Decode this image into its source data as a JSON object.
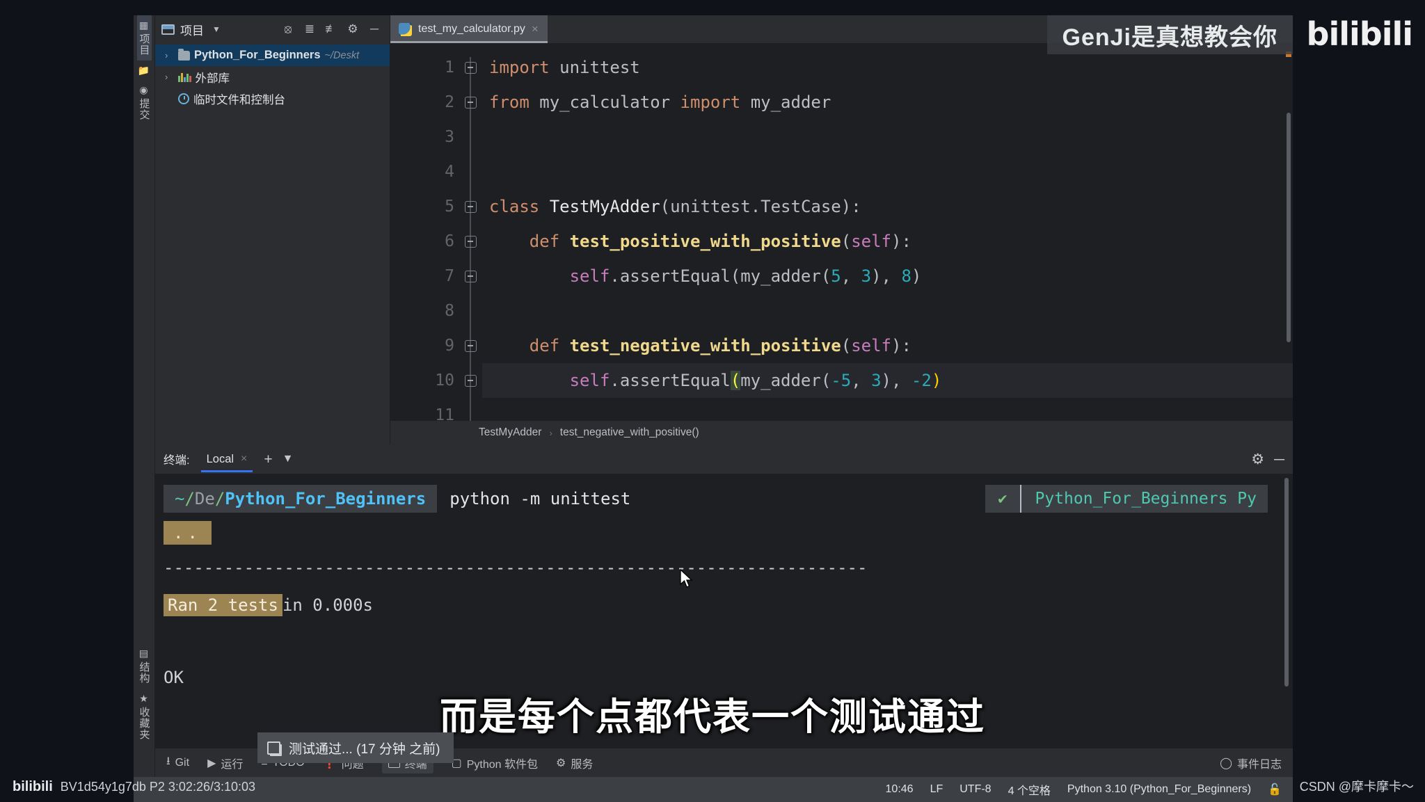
{
  "project": {
    "header_title": "项目",
    "icons": [
      "project-window-icon",
      "dropdown-arrow",
      "locate-icon",
      "expand-all-icon",
      "collapse-all-icon",
      "settings-gear-icon",
      "hide-icon"
    ],
    "tree": [
      {
        "name": "Python_For_Beginners",
        "path": "~/Deskt",
        "arrow": "›",
        "icon": "folder-icon",
        "selected": true
      },
      {
        "name": "外部库",
        "path": "",
        "arrow": "›",
        "icon": "library-icon",
        "selected": false
      },
      {
        "name": "临时文件和控制台",
        "path": "",
        "arrow": "",
        "icon": "scratch-icon",
        "selected": false
      }
    ]
  },
  "toolwindows_left": [
    {
      "label": "项目",
      "icon": "project-icon",
      "active": true
    },
    {
      "label": "提交",
      "icon": "commit-icon",
      "active": false
    },
    {
      "label": "结构",
      "icon": "structure-icon",
      "active": false
    },
    {
      "label": "收藏夹",
      "icon": "bookmarks-star-icon",
      "active": false
    }
  ],
  "editor": {
    "tab": {
      "label": "test_my_calculator.py",
      "icon": "python-file-icon",
      "close": "×"
    },
    "line_numbers": [
      "1",
      "2",
      "3",
      "4",
      "5",
      "6",
      "7",
      "8",
      "9",
      "10",
      "11"
    ],
    "run_markers": [
      5,
      6,
      9
    ],
    "current_line": 10,
    "code": [
      {
        "n": 1,
        "tokens": [
          {
            "t": "import",
            "c": "kw"
          },
          {
            "t": " unittest",
            "c": "plain"
          }
        ]
      },
      {
        "n": 2,
        "tokens": [
          {
            "t": "from",
            "c": "kw"
          },
          {
            "t": " my_calculator ",
            "c": "plain"
          },
          {
            "t": "import",
            "c": "kw"
          },
          {
            "t": " my_adder",
            "c": "plain"
          }
        ]
      },
      {
        "n": 3,
        "tokens": []
      },
      {
        "n": 4,
        "tokens": []
      },
      {
        "n": 5,
        "tokens": [
          {
            "t": "class",
            "c": "kw"
          },
          {
            "t": " ",
            "c": "plain"
          },
          {
            "t": "TestMyAdder",
            "c": "cls"
          },
          {
            "t": "(unittest.TestCase):",
            "c": "plain"
          }
        ]
      },
      {
        "n": 6,
        "tokens": [
          {
            "t": "    ",
            "c": "plain"
          },
          {
            "t": "def",
            "c": "kw"
          },
          {
            "t": " ",
            "c": "plain"
          },
          {
            "t": "test_positive_with_positive",
            "c": "fn"
          },
          {
            "t": "(",
            "c": "plain"
          },
          {
            "t": "self",
            "c": "self"
          },
          {
            "t": "):",
            "c": "plain"
          }
        ]
      },
      {
        "n": 7,
        "tokens": [
          {
            "t": "        ",
            "c": "plain"
          },
          {
            "t": "self",
            "c": "self"
          },
          {
            "t": ".assertEqual(my_adder(",
            "c": "plain"
          },
          {
            "t": "5",
            "c": "num"
          },
          {
            "t": ", ",
            "c": "plain"
          },
          {
            "t": "3",
            "c": "num"
          },
          {
            "t": "), ",
            "c": "plain"
          },
          {
            "t": "8",
            "c": "num"
          },
          {
            "t": ")",
            "c": "plain"
          }
        ]
      },
      {
        "n": 8,
        "tokens": []
      },
      {
        "n": 9,
        "tokens": [
          {
            "t": "    ",
            "c": "plain"
          },
          {
            "t": "def",
            "c": "kw"
          },
          {
            "t": " ",
            "c": "plain"
          },
          {
            "t": "test_negative_with_positive",
            "c": "fn"
          },
          {
            "t": "(",
            "c": "plain"
          },
          {
            "t": "self",
            "c": "self"
          },
          {
            "t": "):",
            "c": "plain"
          }
        ]
      },
      {
        "n": 10,
        "tokens": [
          {
            "t": "        ",
            "c": "plain"
          },
          {
            "t": "self",
            "c": "self"
          },
          {
            "t": ".assertEqual",
            "c": "plain"
          },
          {
            "t": "(",
            "c": "hl-paren"
          },
          {
            "t": "my_adder(",
            "c": "plain"
          },
          {
            "t": "-5",
            "c": "num"
          },
          {
            "t": ", ",
            "c": "plain"
          },
          {
            "t": "3",
            "c": "num"
          },
          {
            "t": "), ",
            "c": "plain"
          },
          {
            "t": "-2",
            "c": "num"
          },
          {
            "t": ")",
            "c": "y-paren"
          }
        ]
      },
      {
        "n": 11,
        "tokens": []
      }
    ],
    "breadcrumb": {
      "class": "TestMyAdder",
      "sep": "›",
      "method": "test_negative_with_positive()"
    }
  },
  "terminal": {
    "label": "终端:",
    "session": "Local",
    "close": "×",
    "add": "+",
    "dropdown": "⌄",
    "gear": "gear-icon",
    "minimize": "─",
    "prompt": {
      "tilde": "~",
      "slash1": "/",
      "de": "De",
      "slash2": "/",
      "project": "Python_For_Beginners"
    },
    "command": "python -m unittest",
    "status_check": "✔",
    "env": "Python_For_Beginners Py",
    "output": {
      "dots": "..",
      "separator": "----------------------------------------------------------------------",
      "ran_highlight": "Ran 2 tests",
      "ran_rest": " in 0.000s",
      "result": "OK"
    }
  },
  "statusbar": {
    "left": [
      {
        "label": "Git",
        "icon": "git-branch-icon"
      },
      {
        "label": "运行",
        "icon": "run-play-icon"
      },
      {
        "label": "TODO",
        "icon": "todo-list-icon"
      },
      {
        "label": "问题",
        "icon": "problems-warning-icon"
      },
      {
        "label": "终端",
        "icon": "terminal-icon"
      },
      {
        "label": "Python 软件包",
        "icon": "python-packages-icon"
      },
      {
        "label": "服务",
        "icon": "services-icon"
      }
    ],
    "right": [
      {
        "label": "事件日志",
        "icon": "event-log-icon"
      }
    ]
  },
  "infostrip": {
    "time": "10:46",
    "line_ending": "LF",
    "encoding": "UTF-8",
    "indent": "4 个空格",
    "interpreter": "Python 3.10 (Python_For_Beginners)",
    "lock_icon": "lock-icon"
  },
  "overlays": {
    "channel": "GenJi是真想教会你",
    "platform_logo": "bilibili",
    "subtitle": "而是每个点都代表一个测试通过",
    "toast": "测试通过... (17 分钟 之前)",
    "video_id": "BV1d54y1g7db P2 3:02:26/3:10:03",
    "watermark_left": "bilibili",
    "csdn": "CSDN @摩卡摩卡～"
  },
  "colors": {
    "accent_blue": "#3574f0",
    "selection": "#113a5c",
    "keyword": "#cf8e6d",
    "function": "#f0d98c",
    "number": "#2aacb8",
    "self": "#c77dbb",
    "terminal_highlight": "#9c8453",
    "success_green": "#7ac47f"
  }
}
